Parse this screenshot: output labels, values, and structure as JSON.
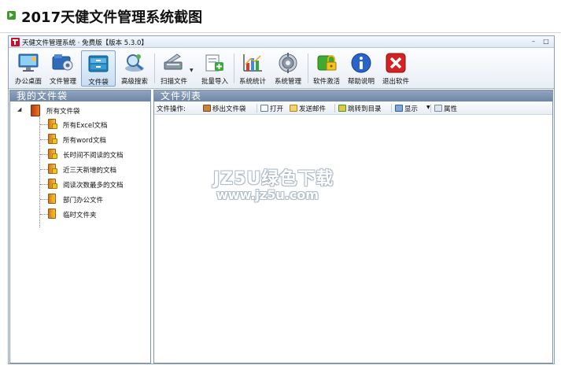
{
  "banner": {
    "title": "2017天健文件管理系统截图"
  },
  "window": {
    "title": "天健文件管理系统 · 免费版【版本 5.3.0】",
    "minimize_glyph": "–",
    "maximize_glyph": "□"
  },
  "toolbar": {
    "items": [
      {
        "label": "办公桌面",
        "icon": "desktop-icon"
      },
      {
        "label": "文件管理",
        "icon": "file-management-icon"
      },
      {
        "label": "文件袋",
        "icon": "file-bag-icon",
        "active": true
      },
      {
        "label": "高级搜索",
        "icon": "advanced-search-icon"
      },
      {
        "label": "扫描文件",
        "icon": "scanner-icon",
        "has_dropdown": true
      },
      {
        "label": "批量导入",
        "icon": "batch-import-icon"
      },
      {
        "label": "系统统计",
        "icon": "statistics-chart-icon"
      },
      {
        "label": "系统管理",
        "icon": "system-settings-icon"
      },
      {
        "label": "软件激活",
        "icon": "activation-lock-icon"
      },
      {
        "label": "帮助说明",
        "icon": "help-info-icon"
      },
      {
        "label": "退出软件",
        "icon": "exit-icon"
      }
    ]
  },
  "left_panel": {
    "header": "我的文件袋",
    "root": {
      "label": "所有文件袋",
      "expander": "◢"
    },
    "items": [
      {
        "label": "所有Excel文档",
        "icon": "locked-folder-icon"
      },
      {
        "label": "所有word文档",
        "icon": "locked-folder-icon"
      },
      {
        "label": "长时间不阅读的文档",
        "icon": "locked-folder-icon"
      },
      {
        "label": "近三天新增的文档",
        "icon": "locked-folder-icon"
      },
      {
        "label": "阅读次数最多的文档",
        "icon": "locked-folder-icon"
      },
      {
        "label": "部门办公文件",
        "icon": "star-folder-icon"
      },
      {
        "label": "临时文件夹",
        "icon": "star-folder-icon"
      }
    ]
  },
  "right_panel": {
    "header": "文件列表",
    "file_ops_label": "文件操作:",
    "actions": [
      {
        "label": "移出文件袋",
        "icon": "remove-from-bag-icon"
      },
      {
        "label": "打开",
        "icon": "open-file-icon"
      },
      {
        "label": "发送邮件",
        "icon": "send-mail-icon"
      },
      {
        "label": "跳转到目录",
        "icon": "jump-to-directory-icon"
      },
      {
        "label": "显示",
        "icon": "view-mode-icon",
        "has_dropdown": true
      },
      {
        "label": "属性",
        "icon": "properties-icon"
      }
    ]
  },
  "watermark": {
    "line1": "JZ5U绿色下载",
    "line2": "www.jz5u.com"
  },
  "colors": {
    "panel_header": "#7a90ae",
    "accent": "#3f9a2a",
    "active_button": "#c9def3"
  }
}
